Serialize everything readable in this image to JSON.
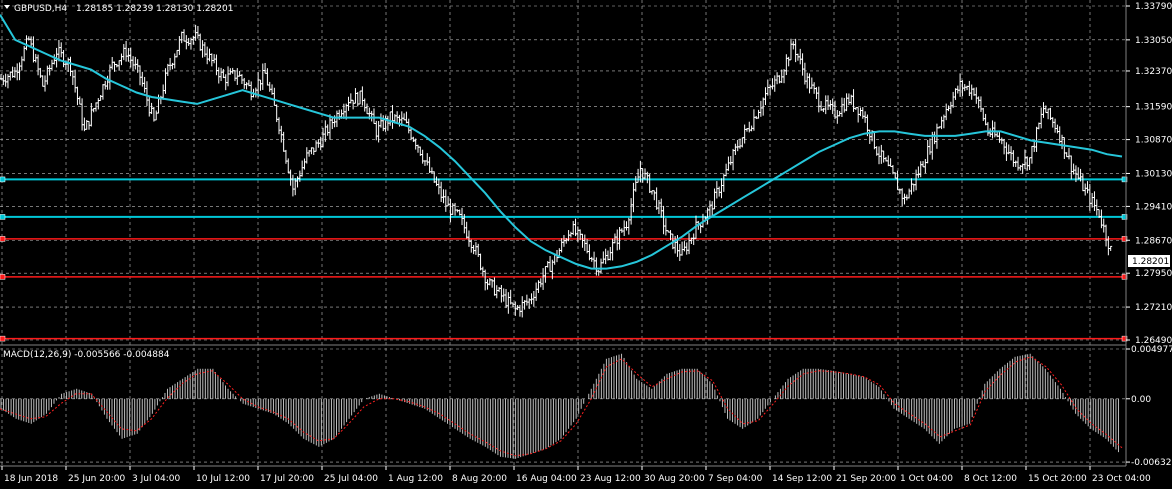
{
  "window": {
    "symbol_label": "GBPUSD,H4",
    "ohlc_text": "1.28185 1.28239 1.28130 1.28201",
    "menu_icon": "triangle-down-icon"
  },
  "colors": {
    "background": "#000000",
    "grid": "#c0c0c0",
    "bars": "#ffffff",
    "ma": "#26c6da",
    "support": "#00c8d8",
    "resistance": "#ff1a1a",
    "macd_signal": "#ff2020",
    "macd_hist": "#bfbfbf",
    "price_tag_bg": "#ffffff",
    "price_tag_fg": "#000000"
  },
  "chart_data": [
    {
      "type": "line",
      "name": "price",
      "title": "GBPUSD,H4",
      "ylim": [
        1.2649,
        1.3379
      ],
      "y_ticks": [
        "1.33790",
        "1.33050",
        "1.32370",
        "1.31590",
        "1.30870",
        "1.30130",
        "1.29410",
        "1.28670",
        "1.27950",
        "1.27210",
        "1.26490"
      ],
      "x_ticks": [
        "18 Jun 2018",
        "25 Jun 20:00",
        "3 Jul 04:00",
        "10 Jul 12:00",
        "17 Jul 20:00",
        "25 Jul 04:00",
        "1 Aug 12:00",
        "8 Aug 20:00",
        "16 Aug 04:00",
        "23 Aug 12:00",
        "30 Aug 20:00",
        "7 Sep 04:00",
        "14 Sep 12:00",
        "21 Sep 20:00",
        "1 Oct 04:00",
        "8 Oct 12:00",
        "15 Oct 20:00",
        "23 Oct 04:00"
      ],
      "last_price": "1.28201",
      "close_series": [
        1.322,
        1.3235,
        1.3305,
        1.3205,
        1.328,
        1.325,
        1.3105,
        1.318,
        1.325,
        1.328,
        1.3225,
        1.3125,
        1.324,
        1.331,
        1.331,
        1.3265,
        1.322,
        1.323,
        1.3195,
        1.323,
        1.312,
        1.298,
        1.305,
        1.3085,
        1.3135,
        1.3175,
        1.318,
        1.3105,
        1.3135,
        1.3125,
        1.3075,
        1.3005,
        1.2945,
        1.2915,
        1.2855,
        1.2775,
        1.2745,
        1.2715,
        1.2735,
        1.279,
        1.2835,
        1.2895,
        1.2855,
        1.2805,
        1.2855,
        1.2905,
        1.3025,
        1.2965,
        1.2875,
        1.2835,
        1.2895,
        1.2935,
        1.3005,
        1.3075,
        1.3125,
        1.3185,
        1.3225,
        1.3295,
        1.3215,
        1.3165,
        1.3145,
        1.3175,
        1.3145,
        1.3065,
        1.3015,
        1.2955,
        1.3015,
        1.3085,
        1.3155,
        1.3205,
        1.3195,
        1.3105,
        1.3085,
        1.3035,
        1.3045,
        1.3155,
        1.311,
        1.303,
        1.2975,
        1.2925,
        1.283
      ],
      "ma_series": [
        1.336,
        1.3305,
        1.329,
        1.3275,
        1.326,
        1.325,
        1.324,
        1.322,
        1.3205,
        1.319,
        1.318,
        1.3175,
        1.317,
        1.3165,
        1.3175,
        1.3185,
        1.3195,
        1.3185,
        1.3175,
        1.3165,
        1.3155,
        1.3145,
        1.3135,
        1.3135,
        1.3135,
        1.3135,
        1.3125,
        1.3115,
        1.3095,
        1.307,
        1.304,
        1.3005,
        1.297,
        1.293,
        1.2895,
        1.2865,
        1.2845,
        1.283,
        1.2815,
        1.2805,
        1.2805,
        1.281,
        1.282,
        1.2835,
        1.2855,
        1.2875,
        1.29,
        1.292,
        1.294,
        1.296,
        1.298,
        1.3,
        1.302,
        1.304,
        1.306,
        1.3075,
        1.309,
        1.31,
        1.3105,
        1.3105,
        1.31,
        1.3095,
        1.3095,
        1.3095,
        1.31,
        1.3105,
        1.3105,
        1.3095,
        1.3085,
        1.308,
        1.3075,
        1.307,
        1.3065,
        1.3055,
        1.305
      ],
      "levels": [
        {
          "label": "",
          "value": 1.3,
          "color": "cyan"
        },
        {
          "label": "",
          "value": 1.2918,
          "color": "cyan"
        },
        {
          "label": "",
          "value": 1.287,
          "color": "red"
        },
        {
          "label": "",
          "value": 1.2787,
          "color": "red"
        },
        {
          "label": "",
          "value": 1.2652,
          "color": "red"
        }
      ]
    },
    {
      "type": "bar",
      "name": "MACD",
      "title": "MACD(12,26,9) -0.005566 -0.004884",
      "ylim": [
        -0.00632,
        0.004977
      ],
      "y_ticks": [
        "0.004977",
        "0.00",
        "-0.006326"
      ],
      "histogram": [
        -0.001,
        -0.002,
        -0.0025,
        -0.0015,
        0.0005,
        0.001,
        0.0005,
        -0.002,
        -0.004,
        -0.0035,
        -0.0015,
        0.001,
        0.002,
        0.003,
        0.003,
        0.001,
        -0.0005,
        -0.001,
        -0.0015,
        -0.0025,
        -0.004,
        -0.0048,
        -0.004,
        -0.002,
        0.0,
        0.0005,
        0.0,
        -0.0005,
        -0.001,
        -0.002,
        -0.003,
        -0.004,
        -0.0048,
        -0.0058,
        -0.006,
        -0.0055,
        -0.005,
        -0.004,
        -0.002,
        0.001,
        0.004,
        0.0045,
        0.002,
        0.001,
        0.0025,
        0.003,
        0.003,
        0.0015,
        -0.002,
        -0.003,
        -0.002,
        0.0,
        0.002,
        0.003,
        0.003,
        0.0028,
        0.0025,
        0.0022,
        0.0012,
        -0.001,
        -0.002,
        -0.003,
        -0.0045,
        -0.003,
        -0.0025,
        0.0015,
        0.003,
        0.0042,
        0.0045,
        0.003,
        0.001,
        -0.0015,
        -0.003,
        -0.004,
        -0.0056
      ],
      "signal": [
        -0.001,
        -0.0015,
        -0.002,
        -0.0018,
        -0.0005,
        0.0005,
        0.0005,
        -0.0012,
        -0.003,
        -0.0032,
        -0.002,
        0.0,
        0.0015,
        0.0025,
        0.0028,
        0.0015,
        0.0,
        -0.0008,
        -0.0013,
        -0.002,
        -0.0033,
        -0.0042,
        -0.004,
        -0.0025,
        -0.0008,
        0.0,
        0.0,
        -0.0003,
        -0.0008,
        -0.0015,
        -0.0025,
        -0.0035,
        -0.0043,
        -0.0052,
        -0.0057,
        -0.0055,
        -0.005,
        -0.0042,
        -0.0025,
        0.0,
        0.0032,
        0.004,
        0.0025,
        0.0012,
        0.002,
        0.0027,
        0.0028,
        0.0018,
        -0.001,
        -0.0025,
        -0.0022,
        -0.0005,
        0.0013,
        0.0025,
        0.0028,
        0.0027,
        0.0025,
        0.0022,
        0.0014,
        -0.0005,
        -0.0015,
        -0.0025,
        -0.0038,
        -0.0032,
        -0.0026,
        0.0008,
        0.0024,
        0.0037,
        0.0042,
        0.0032,
        0.0014,
        -0.001,
        -0.0025,
        -0.0036,
        -0.0049
      ]
    }
  ]
}
